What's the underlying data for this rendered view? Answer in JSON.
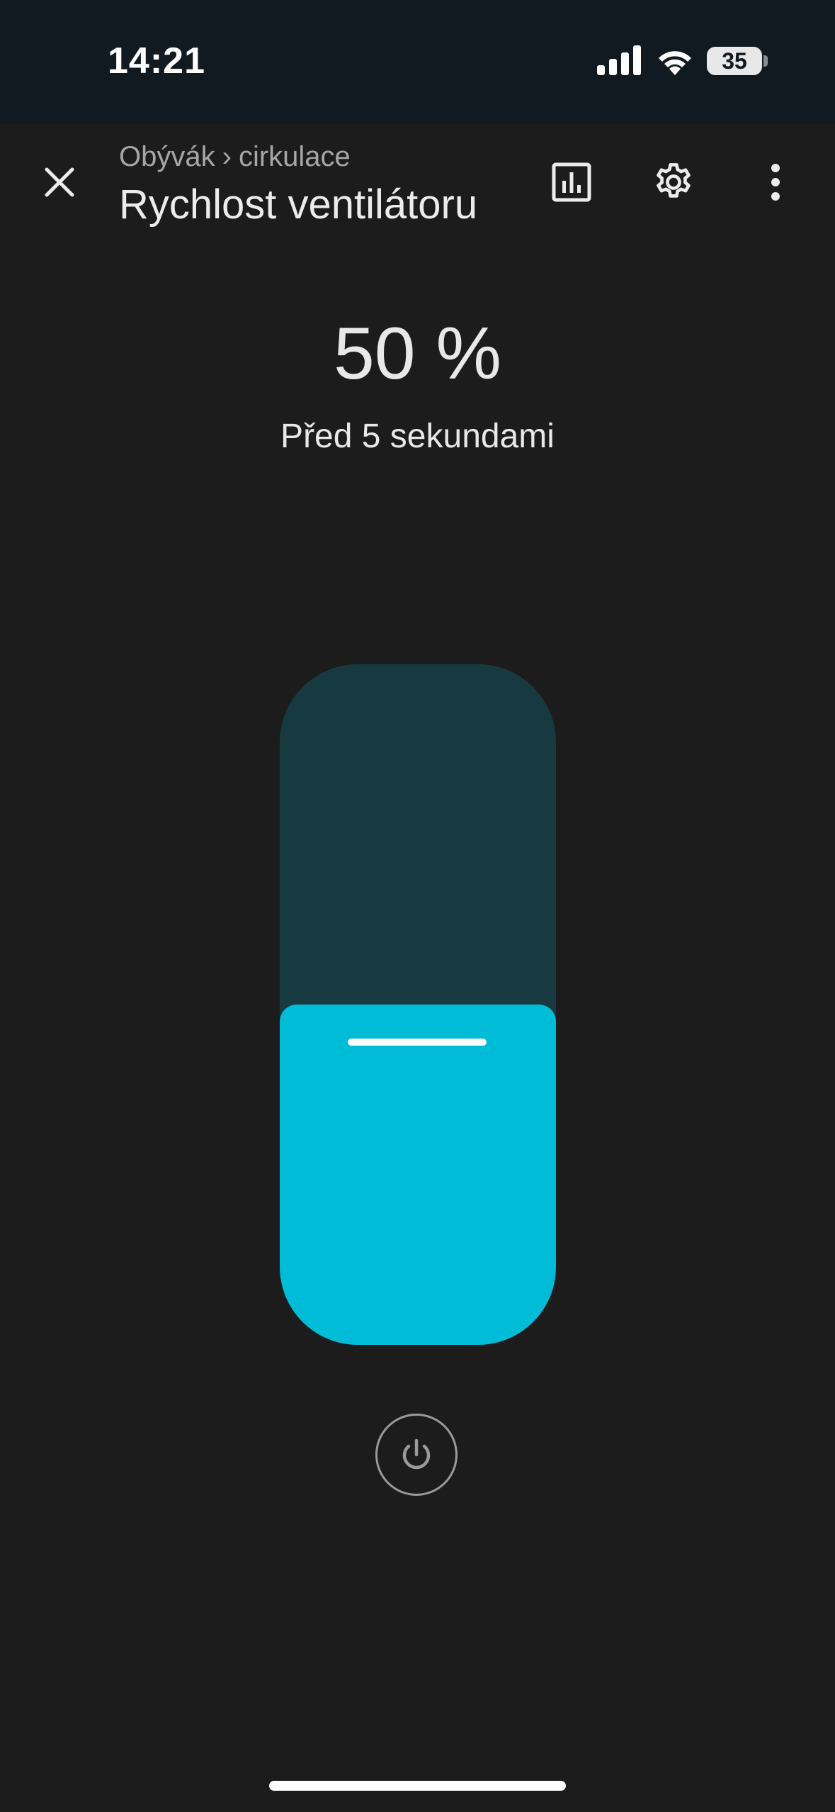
{
  "status_bar": {
    "time": "14:21",
    "battery_level": "35",
    "icons": [
      "signal-icon",
      "wifi-icon",
      "battery-icon"
    ]
  },
  "header": {
    "breadcrumb": {
      "area": "Obývák",
      "separator": "›",
      "device": "cirkulace"
    },
    "title": "Rychlost ventilátoru",
    "actions": [
      "close-icon",
      "chart-icon",
      "gear-icon",
      "more-vert-icon"
    ]
  },
  "value": {
    "display": "50 %",
    "fraction": 0.5,
    "updated": "Před 5 sekundami"
  },
  "colors": {
    "accent": "#00bcd6",
    "track": "#173a41",
    "background": "#1c1c1c",
    "status_bar": "#111a20"
  },
  "controls": {
    "power_icon": "power-icon"
  }
}
